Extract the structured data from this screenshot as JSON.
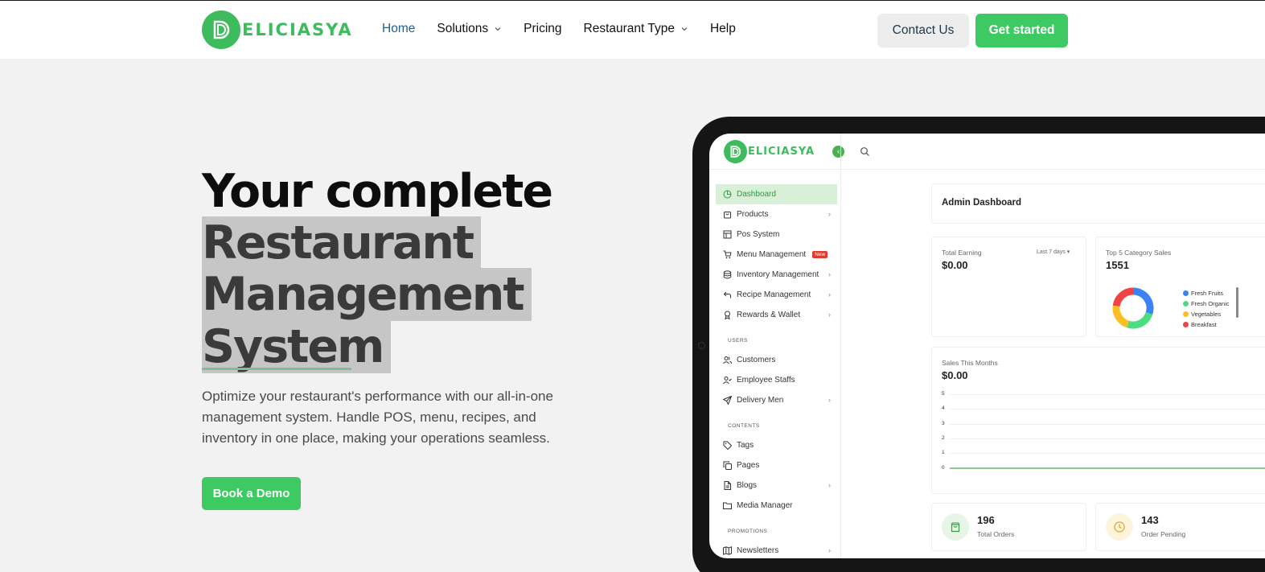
{
  "header": {
    "brand": "ELICIASYA",
    "nav": [
      {
        "label": "Home",
        "active": true,
        "dropdown": false
      },
      {
        "label": "Solutions",
        "active": false,
        "dropdown": true
      },
      {
        "label": "Pricing",
        "active": false,
        "dropdown": false
      },
      {
        "label": "Restaurant Type",
        "active": false,
        "dropdown": true
      },
      {
        "label": "Help",
        "active": false,
        "dropdown": false
      }
    ],
    "contact_label": "Contact Us",
    "start_label": "Get started"
  },
  "hero": {
    "title_line1": "Your complete",
    "title_line2": "Restaurant",
    "title_line3": "Management",
    "title_line4": "System",
    "description": "Optimize your restaurant's performance with our all-in-one management system. Handle POS, menu, recipes, and inventory in one place, making your operations seamless.",
    "demo_label": "Book a Demo"
  },
  "dashboard": {
    "brand": "ELICIASYA",
    "sidebar": {
      "main": [
        {
          "label": "Dashboard",
          "icon": "dashboard-icon",
          "arrow": false,
          "active": true
        },
        {
          "label": "Products",
          "icon": "bag-icon",
          "arrow": true
        },
        {
          "label": "Pos System",
          "icon": "grid-icon",
          "arrow": false
        },
        {
          "label": "Menu Management",
          "icon": "cart-icon",
          "arrow": false,
          "badge": "New"
        },
        {
          "label": "Inventory Management",
          "icon": "database-icon",
          "arrow": true
        },
        {
          "label": "Recipe Management",
          "icon": "undo-icon",
          "arrow": true
        },
        {
          "label": "Rewards & Wallet",
          "icon": "award-icon",
          "arrow": true
        }
      ],
      "users_section": "USERS",
      "users": [
        {
          "label": "Customers",
          "icon": "users-icon",
          "arrow": false
        },
        {
          "label": "Employee Staffs",
          "icon": "user-check-icon",
          "arrow": false
        },
        {
          "label": "Delivery Men",
          "icon": "send-icon",
          "arrow": true
        }
      ],
      "contents_section": "CONTENTS",
      "contents": [
        {
          "label": "Tags",
          "icon": "tag-icon",
          "arrow": false
        },
        {
          "label": "Pages",
          "icon": "copy-icon",
          "arrow": false
        },
        {
          "label": "Blogs",
          "icon": "file-icon",
          "arrow": true
        },
        {
          "label": "Media Manager",
          "icon": "folder-icon",
          "arrow": false
        }
      ],
      "promotions_section": "PROMOTIONS",
      "promotions": [
        {
          "label": "Newsletters",
          "icon": "map-icon",
          "arrow": true
        }
      ]
    },
    "admin_title": "Admin Dashboard",
    "total_earning_label": "Total Earning",
    "total_earning_value": "$0.00",
    "earning_filter": "Last 7 days",
    "top5_label": "Top 5 Category Sales",
    "top5_value": "1551",
    "sales_label": "Sales This Months",
    "sales_value": "$0.00",
    "stats": [
      {
        "value": "196",
        "label": "Total Orders"
      },
      {
        "value": "143",
        "label": "Order Pending"
      }
    ]
  },
  "chart_data": [
    {
      "type": "pie",
      "title": "Top 5 Category Sales",
      "categories": [
        "Fresh Fruits",
        "Fresh Organic",
        "Vegetables",
        "Breakfast"
      ],
      "colors": [
        "#3b82f6",
        "#4ade80",
        "#fbbf24",
        "#ef4444"
      ],
      "values": [
        30,
        25,
        22,
        23
      ]
    },
    {
      "type": "line",
      "title": "Sales This Months",
      "y_ticks": [
        "5",
        "4",
        "3",
        "2",
        "1",
        "0"
      ],
      "ylim": [
        0,
        5
      ],
      "series": [
        {
          "values": [
            0,
            0,
            0,
            0,
            0,
            0,
            0,
            0
          ]
        }
      ],
      "color": "#4caf50"
    }
  ]
}
